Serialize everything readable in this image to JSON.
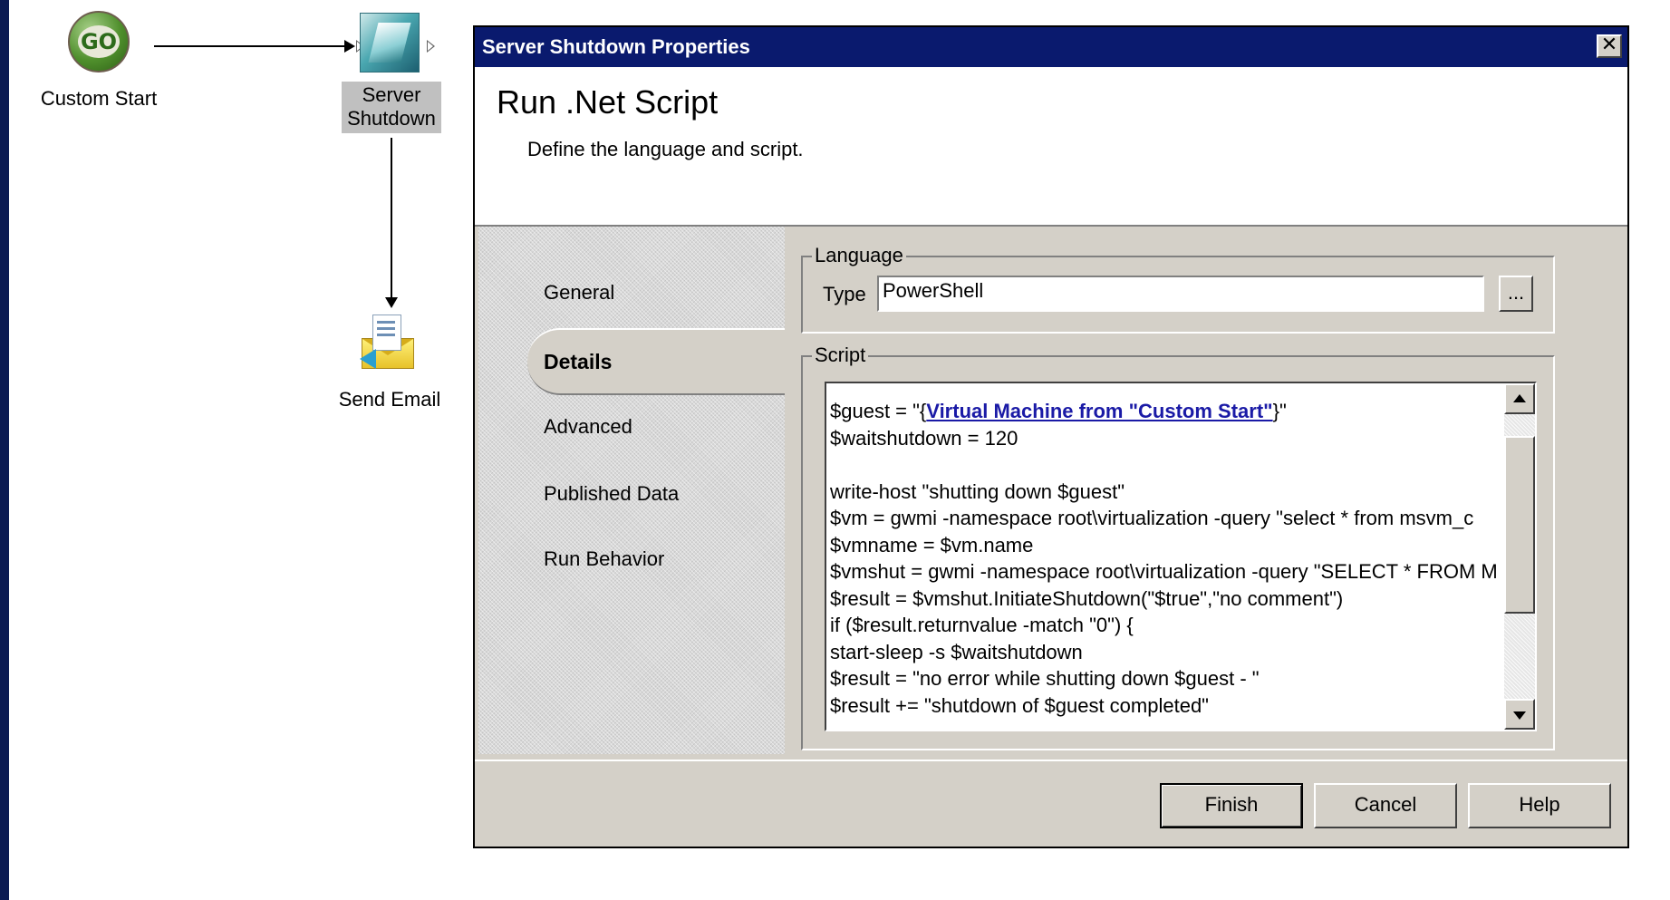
{
  "workflow": {
    "nodes": [
      {
        "label": "Custom Start",
        "icon": "go-icon",
        "icon_text": "GO"
      },
      {
        "label_lines": [
          "Server",
          "Shutdown"
        ],
        "icon": "server-shutdown-icon"
      },
      {
        "label": "Send Email",
        "icon": "send-email-icon"
      }
    ]
  },
  "dialog": {
    "title": "Server Shutdown Properties",
    "close_glyph": "✕",
    "heading": "Run .Net Script",
    "subheading": "Define the language and script.",
    "nav": [
      {
        "label": "General"
      },
      {
        "label": "Details",
        "active": true
      },
      {
        "label": "Advanced"
      },
      {
        "label": "Published Data"
      },
      {
        "label": "Run Behavior"
      }
    ],
    "language": {
      "legend": "Language",
      "type_label": "Type",
      "type_value": "PowerShell",
      "browse_label": "..."
    },
    "script": {
      "legend": "Script",
      "line1_prefix": "$guest = \"{",
      "line1_link": "Virtual Machine from \"Custom Start\"",
      "line1_suffix": "}\"",
      "lines": [
        "$waitshutdown = 120",
        "",
        "write-host \"shutting down $guest\"",
        "$vm = gwmi -namespace root\\virtualization -query \"select * from msvm_c",
        "$vmname = $vm.name",
        "$vmshut = gwmi -namespace root\\virtualization -query \"SELECT * FROM M",
        "$result = $vmshut.InitiateShutdown(\"$true\",\"no comment\")",
        "if ($result.returnvalue -match \"0\") {",
        "start-sleep -s $waitshutdown",
        "$result = \"no error while shutting down $guest - \"",
        "$result += \"shutdown of $guest completed\""
      ]
    },
    "buttons": {
      "finish": "Finish",
      "cancel": "Cancel",
      "help": "Help"
    },
    "colors": {
      "titlebar": "#0a1a6e",
      "link": "#1a1aa6",
      "panel": "#d4d0c8",
      "desktop": "#0b1a52"
    }
  }
}
